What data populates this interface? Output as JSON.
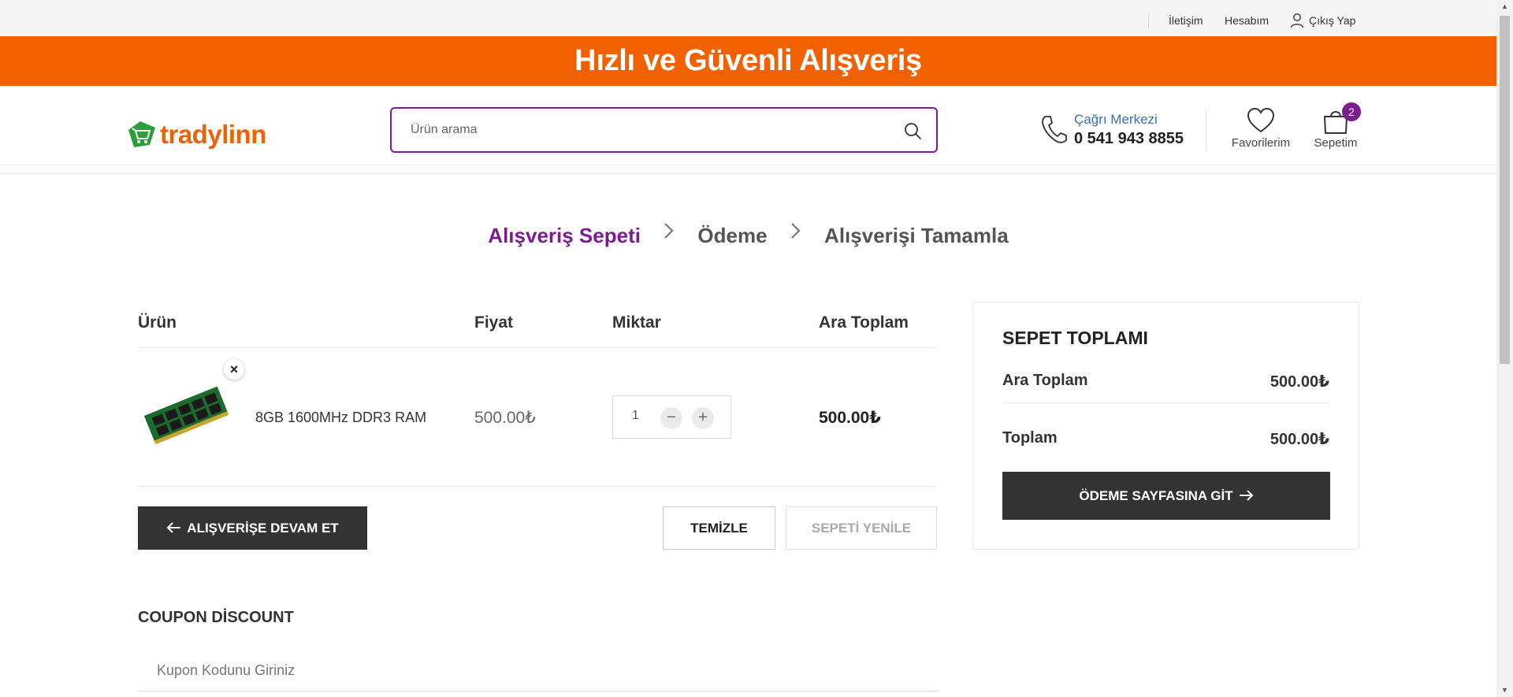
{
  "topbar": {
    "contact": "İletişim",
    "account": "Hesabım",
    "logout": "Çıkış Yap"
  },
  "banner": {
    "text": "Hızlı ve Güvenli Alışveriş"
  },
  "header": {
    "logo_text": "tradylinn",
    "search_placeholder": "Ürün arama",
    "call_center_label": "Çağrı Merkezi",
    "call_center_number": "0 541 943 8855",
    "favorites_label": "Favorilerim",
    "cart_label": "Sepetim",
    "cart_count": "2"
  },
  "steps": [
    "Alışveriş Sepeti",
    "Ödeme",
    "Alışverişi Tamamla"
  ],
  "cart_table": {
    "headers": {
      "product": "Ürün",
      "price": "Fiyat",
      "quantity": "Miktar",
      "subtotal": "Ara Toplam"
    },
    "items": [
      {
        "remove": "×",
        "name": "8GB 1600MHz DDR3 RAM",
        "price": "500.00₺",
        "quantity": "1",
        "subtotal": "500.00₺"
      }
    ]
  },
  "actions": {
    "continue": "ALIŞVERİŞE DEVAM ET",
    "clear": "TEMİZLE",
    "refresh": "SEPETİ YENİLE"
  },
  "coupon": {
    "title": "COUPON DİSCOUNT",
    "placeholder": "Kupon Kodunu Giriniz"
  },
  "totals": {
    "title": "SEPET TOPLAMI",
    "subtotal_label": "Ara Toplam",
    "subtotal_value": "500.00₺",
    "total_label": "Toplam",
    "total_value": "500.00₺",
    "checkout": "ÖDEME SAYFASINA GİT"
  },
  "colors": {
    "brand_orange": "#f26100",
    "brand_purple": "#7b1c8f",
    "dark": "#333333"
  },
  "icons": [
    "user-icon",
    "search-icon",
    "phone-icon",
    "heart-icon",
    "bag-icon",
    "arrow-left-icon",
    "arrow-right-icon",
    "chevron-right-icon",
    "minus-icon",
    "plus-icon",
    "close-icon"
  ]
}
